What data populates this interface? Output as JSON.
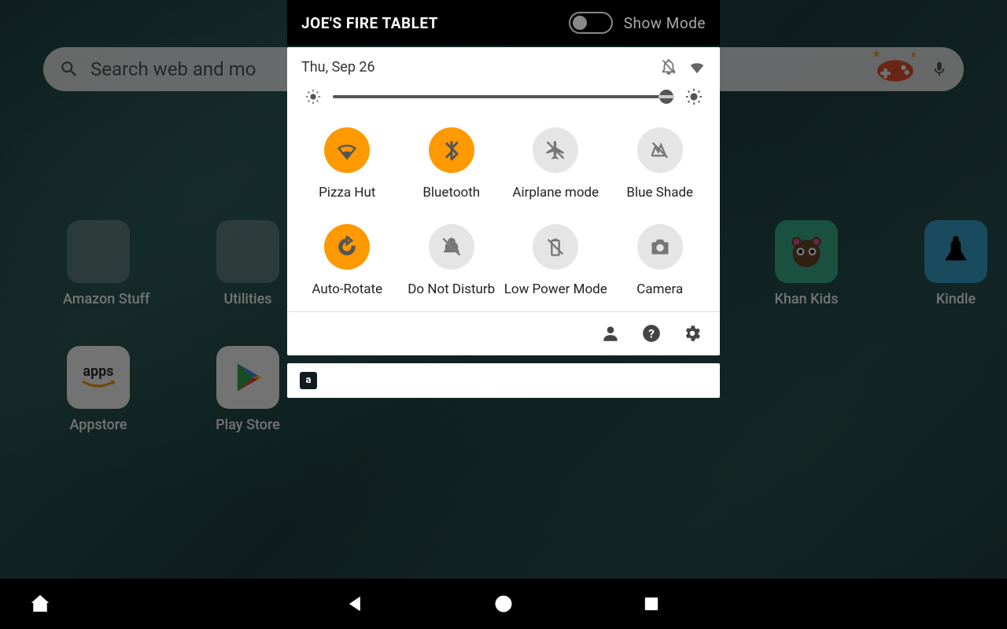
{
  "device_name": "JOE'S FIRE TABLET",
  "show_mode_label": "Show Mode",
  "search_placeholder": "Search web and mo",
  "date_label": "Thu, Sep 26",
  "brightness_percent": 95,
  "tiles": [
    {
      "label": "Pizza Hut",
      "active": true,
      "icon": "wifi"
    },
    {
      "label": "Bluetooth",
      "active": true,
      "icon": "bluetooth"
    },
    {
      "label": "Airplane mode",
      "active": false,
      "icon": "airplane"
    },
    {
      "label": "Blue Shade",
      "active": false,
      "icon": "blueshade"
    },
    {
      "label": "Auto-Rotate",
      "active": true,
      "icon": "rotate"
    },
    {
      "label": "Do Not Disturb",
      "active": false,
      "icon": "dnd"
    },
    {
      "label": "Low Power Mode",
      "active": false,
      "icon": "lowpower"
    },
    {
      "label": "Camera",
      "active": false,
      "icon": "camera"
    }
  ],
  "home_apps_row1": [
    {
      "label": "Amazon Stuff"
    },
    {
      "label": "Utilities"
    },
    {
      "label": "Khan Kids"
    },
    {
      "label": "Kindle"
    }
  ],
  "home_apps_row2": [
    {
      "label": "Appstore"
    },
    {
      "label": "Play Store"
    }
  ],
  "colors": {
    "accent": "#ff9900"
  }
}
